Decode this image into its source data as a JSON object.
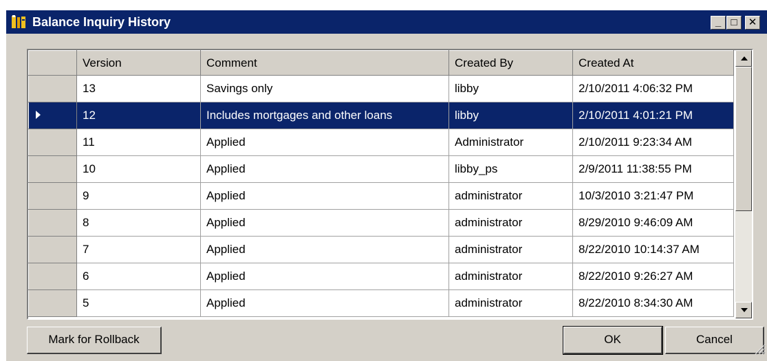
{
  "window": {
    "title": "Balance Inquiry History",
    "icon": "app-tools-icon",
    "controls": {
      "minimize": "_",
      "maximize": "□",
      "close": "✕"
    }
  },
  "grid": {
    "columns": [
      "Version",
      "Comment",
      "Created By",
      "Created At"
    ],
    "selected_version": "12",
    "rows": [
      {
        "version": "13",
        "comment": "Savings only",
        "created_by": "libby",
        "created_at": "2/10/2011 4:06:32 PM"
      },
      {
        "version": "12",
        "comment": "Includes mortgages and other loans",
        "created_by": "libby",
        "created_at": "2/10/2011 4:01:21 PM"
      },
      {
        "version": "11",
        "comment": "Applied",
        "created_by": "Administrator",
        "created_at": "2/10/2011 9:23:34 AM"
      },
      {
        "version": "10",
        "comment": "Applied",
        "created_by": "libby_ps",
        "created_at": "2/9/2011 11:38:55 PM"
      },
      {
        "version": "9",
        "comment": "Applied",
        "created_by": "administrator",
        "created_at": "10/3/2010 3:21:47 PM"
      },
      {
        "version": "8",
        "comment": "Applied",
        "created_by": "administrator",
        "created_at": "8/29/2010 9:46:09 AM"
      },
      {
        "version": "7",
        "comment": "Applied",
        "created_by": "administrator",
        "created_at": "8/22/2010 10:14:37 AM"
      },
      {
        "version": "6",
        "comment": "Applied",
        "created_by": "administrator",
        "created_at": "8/22/2010 9:26:27 AM"
      },
      {
        "version": "5",
        "comment": "Applied",
        "created_by": "administrator",
        "created_at": "8/22/2010 8:34:30 AM"
      }
    ]
  },
  "buttons": {
    "rollback": "Mark for Rollback",
    "ok": "OK",
    "cancel": "Cancel"
  },
  "colors": {
    "titlebar": "#0a246a",
    "selection": "#0a246a",
    "face": "#d4d0c8"
  }
}
